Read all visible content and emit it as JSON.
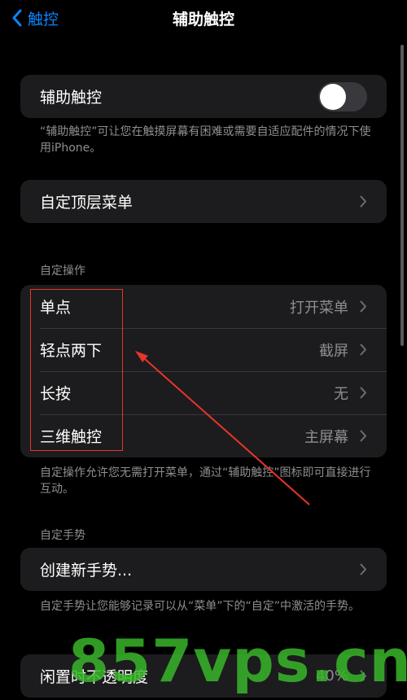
{
  "nav": {
    "back_label": "触控",
    "title": "辅助触控"
  },
  "assistive_touch": {
    "label": "辅助触控",
    "on": false
  },
  "footnotes": {
    "assistive": "“辅助触控”可让您在触摸屏幕有困难或需要自适应配件的情况下使用iPhone。",
    "actions": "自定操作允许您无需打开菜单，通过“辅助触控”图标即可直接进行互动。",
    "gestures": "自定手势让您能够记录可以从“菜单”下的“自定”中激活的手势。"
  },
  "top_menu": {
    "label": "自定顶层菜单"
  },
  "custom_actions": {
    "header": "自定操作",
    "items": [
      {
        "label": "单点",
        "value": "打开菜单"
      },
      {
        "label": "轻点两下",
        "value": "截屏"
      },
      {
        "label": "长按",
        "value": "无"
      },
      {
        "label": "三维触控",
        "value": "主屏幕"
      }
    ]
  },
  "custom_gestures": {
    "header": "自定手势",
    "create_label": "创建新手势..."
  },
  "idle_opacity": {
    "label": "闲置时不透明度",
    "value": "40%"
  },
  "watermark": "857vps.cn",
  "colors": {
    "accent": "#0a84ff",
    "annotation": "#e8352b",
    "watermark": "#39b62a"
  }
}
